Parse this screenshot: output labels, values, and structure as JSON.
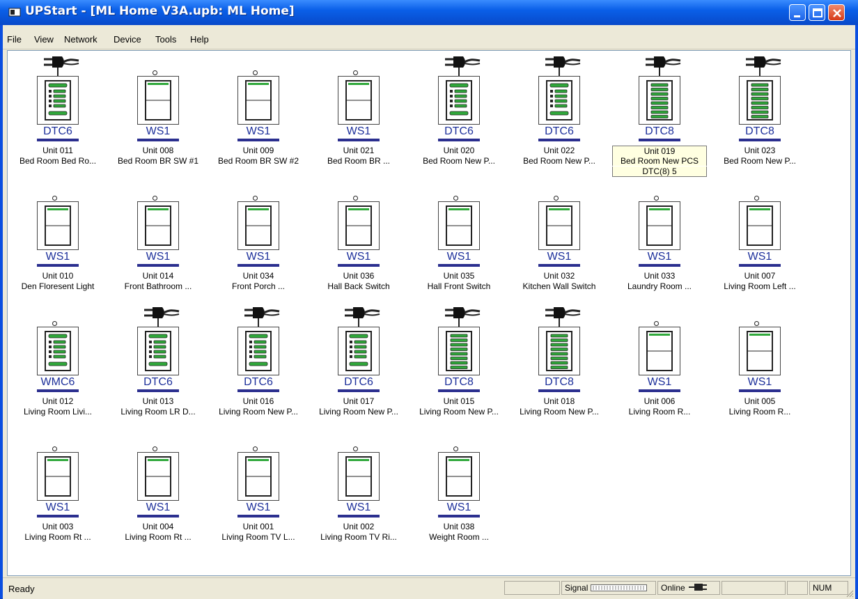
{
  "window": {
    "title": "UPStart - [ML Home V3A.upb: ML Home]"
  },
  "menu": [
    "File",
    "View",
    "Network",
    "Device",
    "Tools",
    "Help"
  ],
  "devices": [
    {
      "unit": "Unit 011",
      "name": "Bed Room Bed Ro...",
      "model": "DTC6",
      "kind": "dtc6",
      "plug": true
    },
    {
      "unit": "Unit 008",
      "name": "Bed Room BR SW #1",
      "model": "WS1",
      "kind": "ws1",
      "plug": false
    },
    {
      "unit": "Unit 009",
      "name": "Bed Room BR SW #2",
      "model": "WS1",
      "kind": "ws1",
      "plug": false
    },
    {
      "unit": "Unit 021",
      "name": "Bed Room BR ...",
      "model": "WS1",
      "kind": "ws1",
      "plug": false
    },
    {
      "unit": "Unit 020",
      "name": "Bed Room New P...",
      "model": "DTC6",
      "kind": "dtc6",
      "plug": true
    },
    {
      "unit": "Unit 022",
      "name": "Bed Room New P...",
      "model": "DTC6",
      "kind": "dtc6",
      "plug": true
    },
    {
      "unit": "Unit 019",
      "name": "Bed Room New PCS",
      "extra": "DTC(8) 5",
      "model": "DTC8",
      "kind": "dtc8",
      "plug": true,
      "selected": true
    },
    {
      "unit": "Unit 023",
      "name": "Bed Room New P...",
      "model": "DTC8",
      "kind": "dtc8",
      "plug": true
    },
    {
      "unit": "Unit 010",
      "name": "Den Floresent Light",
      "model": "WS1",
      "kind": "ws1",
      "plug": false
    },
    {
      "unit": "Unit 014",
      "name": "Front Bathroom ...",
      "model": "WS1",
      "kind": "ws1",
      "plug": false
    },
    {
      "unit": "Unit 034",
      "name": "Front Porch ...",
      "model": "WS1",
      "kind": "ws1",
      "plug": false
    },
    {
      "unit": "Unit 036",
      "name": "Hall Back Switch",
      "model": "WS1",
      "kind": "ws1",
      "plug": false
    },
    {
      "unit": "Unit 035",
      "name": "Hall Front Switch",
      "model": "WS1",
      "kind": "ws1",
      "plug": false
    },
    {
      "unit": "Unit 032",
      "name": "Kitchen Wall Switch",
      "model": "WS1",
      "kind": "ws1",
      "plug": false
    },
    {
      "unit": "Unit 033",
      "name": "Laundry Room ...",
      "model": "WS1",
      "kind": "ws1",
      "plug": false
    },
    {
      "unit": "Unit 007",
      "name": "Living Room Left ...",
      "model": "WS1",
      "kind": "ws1",
      "plug": false
    },
    {
      "unit": "Unit 012",
      "name": "Living Room Livi...",
      "model": "WMC6",
      "kind": "dtc6",
      "plug": false
    },
    {
      "unit": "Unit 013",
      "name": "Living Room LR D...",
      "model": "DTC6",
      "kind": "dtc6",
      "plug": true
    },
    {
      "unit": "Unit 016",
      "name": "Living Room New P...",
      "model": "DTC6",
      "kind": "dtc6",
      "plug": true
    },
    {
      "unit": "Unit 017",
      "name": "Living Room New P...",
      "model": "DTC6",
      "kind": "dtc6",
      "plug": true
    },
    {
      "unit": "Unit 015",
      "name": "Living Room New P...",
      "model": "DTC8",
      "kind": "dtc8",
      "plug": true
    },
    {
      "unit": "Unit 018",
      "name": "Living Room New P...",
      "model": "DTC8",
      "kind": "dtc8",
      "plug": true
    },
    {
      "unit": "Unit 006",
      "name": "Living Room R...",
      "model": "WS1",
      "kind": "ws1",
      "plug": false
    },
    {
      "unit": "Unit 005",
      "name": "Living Room R...",
      "model": "WS1",
      "kind": "ws1",
      "plug": false
    },
    {
      "unit": "Unit 003",
      "name": "Living Room Rt ...",
      "model": "WS1",
      "kind": "ws1",
      "plug": false
    },
    {
      "unit": "Unit 004",
      "name": "Living Room Rt ...",
      "model": "WS1",
      "kind": "ws1",
      "plug": false
    },
    {
      "unit": "Unit 001",
      "name": "Living Room TV L...",
      "model": "WS1",
      "kind": "ws1",
      "plug": false
    },
    {
      "unit": "Unit 002",
      "name": "Living Room TV Ri...",
      "model": "WS1",
      "kind": "ws1",
      "plug": false
    },
    {
      "unit": "Unit 038",
      "name": "Weight Room ...",
      "model": "WS1",
      "kind": "ws1",
      "plug": false
    }
  ],
  "status": {
    "text": "Ready",
    "signal_label": "Signal",
    "online_label": "Online",
    "num": "NUM"
  },
  "colors": {
    "title_bar": "#0a5fe8",
    "model_text": "#1c2f9a",
    "led_green": "#2fa83a",
    "tooltip_bg": "#ffffe1"
  }
}
